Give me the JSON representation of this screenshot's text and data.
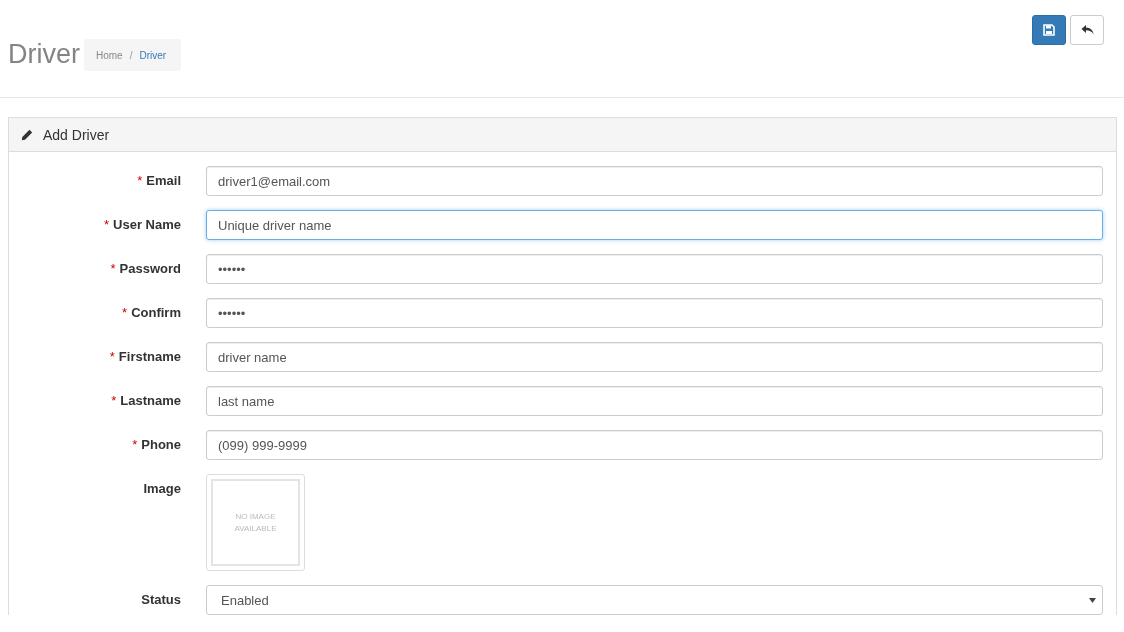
{
  "page": {
    "title": "Driver"
  },
  "breadcrumb": [
    {
      "label": "Home",
      "current": false
    },
    {
      "separator": "/",
      "label": "Driver",
      "current": true
    }
  ],
  "panel": {
    "title": "Add Driver"
  },
  "fields": [
    {
      "kind": "text",
      "required_mark": "*",
      "label": "Email",
      "value": "driver1@email.com",
      "focused": false
    },
    {
      "kind": "text",
      "required_mark": "*",
      "label": "User Name",
      "value": "Unique driver name",
      "focused": true
    },
    {
      "kind": "text",
      "required_mark": "*",
      "label": "Password",
      "value": "••••••",
      "focused": false
    },
    {
      "kind": "text",
      "required_mark": "*",
      "label": "Confirm",
      "value": "••••••",
      "focused": false
    },
    {
      "kind": "text",
      "required_mark": "*",
      "label": "Firstname",
      "value": "driver name",
      "focused": false
    },
    {
      "kind": "text",
      "required_mark": "*",
      "label": "Lastname",
      "value": "last name",
      "focused": false
    },
    {
      "kind": "text",
      "required_mark": "*",
      "label": "Phone",
      "value": "(099) 999-9999",
      "focused": false
    },
    {
      "kind": "image",
      "label": "Image",
      "placeholder_lines": [
        "NO IMAGE",
        "AVAILABLE"
      ]
    },
    {
      "kind": "select",
      "label": "Status",
      "value": "Enabled"
    }
  ]
}
